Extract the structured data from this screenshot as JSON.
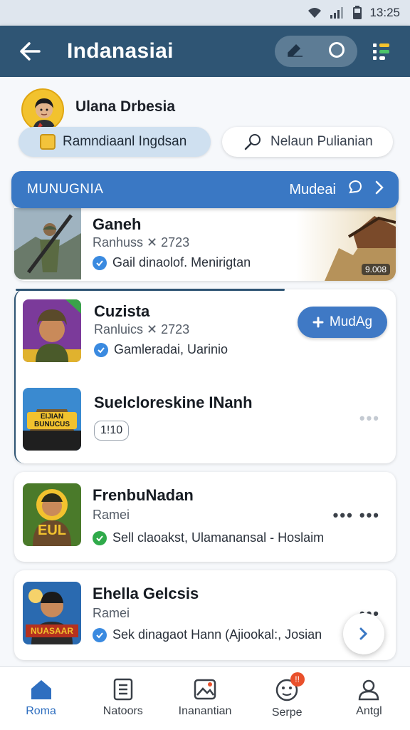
{
  "status_bar": {
    "time": "13:25"
  },
  "app_bar": {
    "title": "Indanasiai"
  },
  "profile": {
    "name": "Ulana Drbesia",
    "primary_chip": "Ramndiaanl Ingdsan",
    "secondary_chip": "Nelaun Pulianian"
  },
  "section": {
    "title": "MUNUGNIA",
    "action": "Mudeai"
  },
  "items": [
    {
      "title": "Ganeh",
      "subtitle": "Ranhuss ✕ 2723",
      "status": "Gail dinaolof. Menirigtan",
      "badge": "9.008"
    },
    {
      "title": "Cuzista",
      "subtitle": "Ranluics ✕ 2723",
      "status": "Gamleradai, Uarinio",
      "action": "MudAg"
    },
    {
      "title": "Suelcloreskine INanh",
      "tag": "1!10",
      "thumb_text": "EIJIAN BUNUCUS"
    },
    {
      "title": "FrenbuNadan",
      "subtitle": "Ramei",
      "status": "Sell claoakst, Ulamanansal - Hoslaim",
      "thumb_text": "EUL"
    },
    {
      "title": "Ehella Gelcsis",
      "subtitle": "Ramei",
      "status": "Sek dinagaot Hann (Ajiookal:, Josian",
      "thumb_text": "NUASAAR"
    }
  ],
  "bottom_nav": [
    {
      "label": "Roma",
      "icon": "home-icon",
      "active": true
    },
    {
      "label": "Natoors",
      "icon": "document-icon"
    },
    {
      "label": "Inanantian",
      "icon": "image-icon"
    },
    {
      "label": "Serpe",
      "icon": "face-icon",
      "badge": "!!"
    },
    {
      "label": "Antgl",
      "icon": "person-icon"
    }
  ],
  "colors": {
    "app_bar": "#2f5574",
    "accent": "#3a78c4",
    "success": "#2faa4a"
  }
}
